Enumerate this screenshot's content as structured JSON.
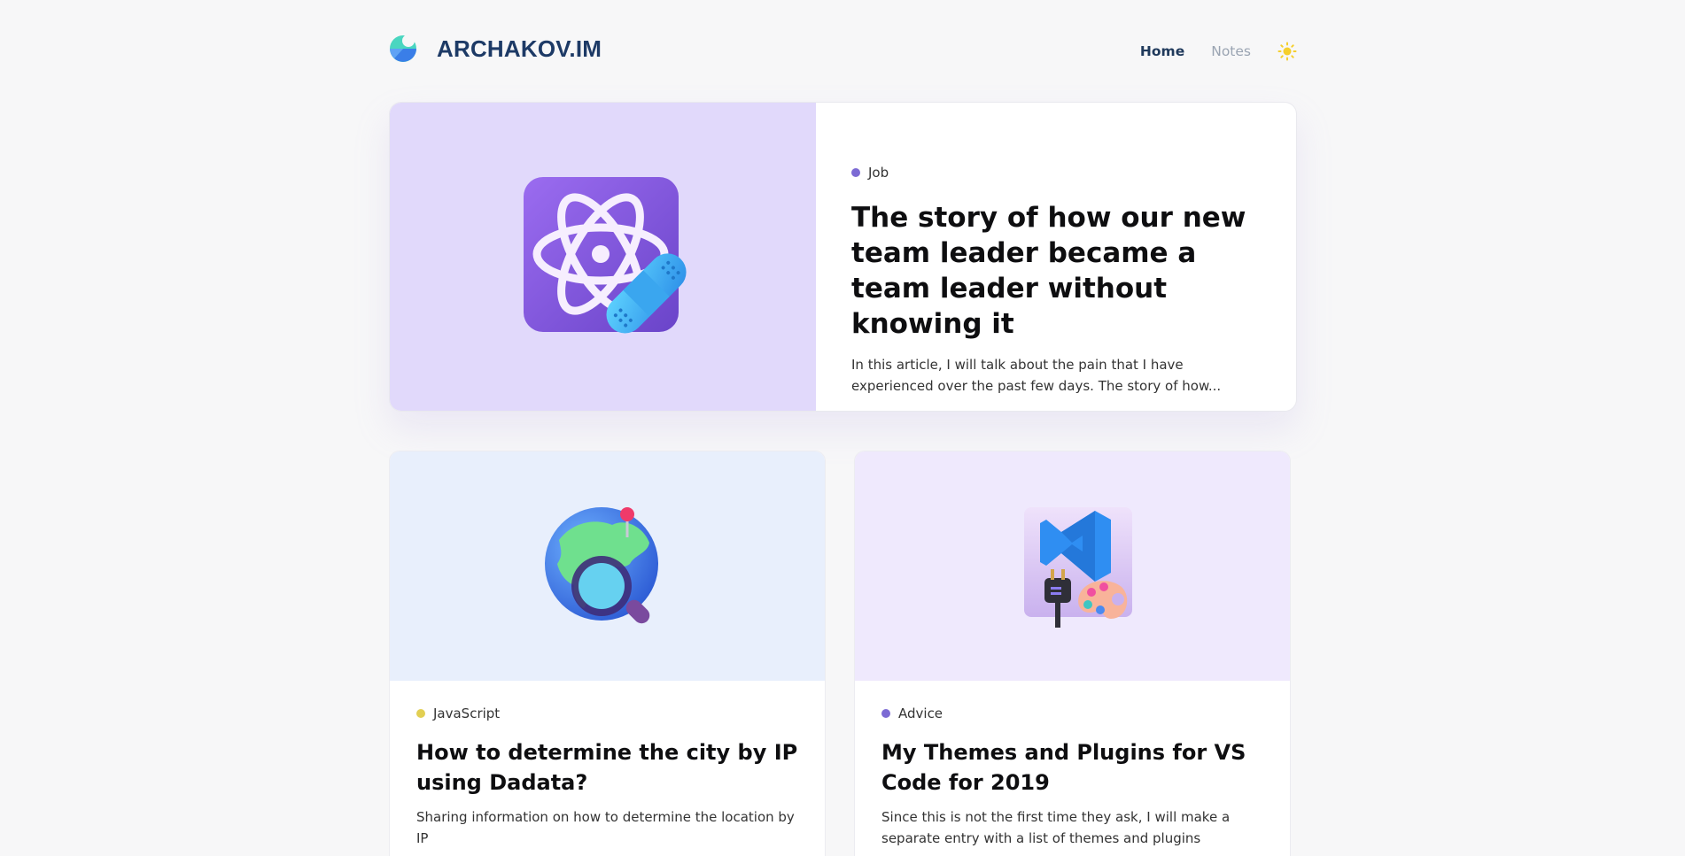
{
  "site": {
    "logo_text": "ARCHAKOV.IM",
    "logo_icon": "pie-logo-icon"
  },
  "nav": {
    "items": [
      {
        "label": "Home",
        "active": true
      },
      {
        "label": "Notes",
        "active": false
      }
    ],
    "theme_toggle_icon": "sun-icon"
  },
  "featured": {
    "tag": "Job",
    "tag_color": "#7c6ad4",
    "title": "The story of how our new team leader became a team leader without knowing it",
    "excerpt": "In this article, I will talk about the pain that I have experienced over the past few days. The story of how...",
    "image_icon": "atom-with-bandage-icon",
    "image_bg": "#e1d9fb"
  },
  "posts": [
    {
      "tag": "JavaScript",
      "tag_color": "#e2cf52",
      "title": "How to determine the city by IP using Dadata?",
      "excerpt": "Sharing information on how to determine the location by IP",
      "image_icon": "globe-magnifier-icon",
      "image_bg": "#e8effc"
    },
    {
      "tag": "Advice",
      "tag_color": "#7c6ad4",
      "title": "My Themes and Plugins for VS Code for 2019",
      "excerpt": "Since this is not the first time they ask, I will make a separate entry with a list of themes and plugins",
      "image_icon": "vscode-plugin-palette-icon",
      "image_bg": "#efe9fd"
    }
  ]
}
